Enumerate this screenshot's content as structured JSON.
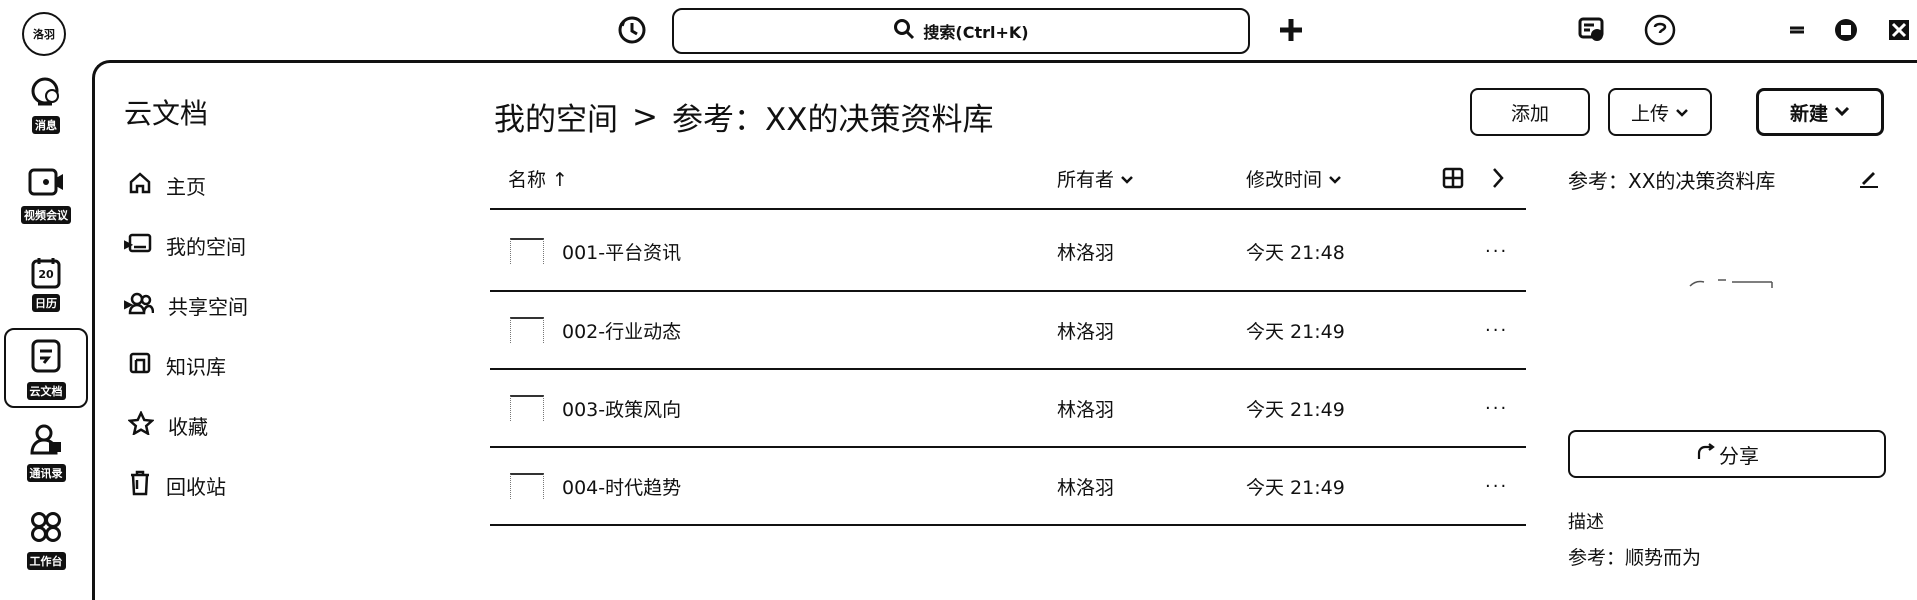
{
  "topbar": {
    "avatar_text": "洛羽",
    "search_label": "搜索(Ctrl+K)"
  },
  "rail": [
    {
      "label": "消息",
      "icon": "chat-icon"
    },
    {
      "label": "视频会议",
      "icon": "video-icon"
    },
    {
      "label": "日历",
      "icon": "calendar-icon",
      "day": "20"
    },
    {
      "label": "云文档",
      "icon": "document-icon",
      "active": true
    },
    {
      "label": "通讯录",
      "icon": "contacts-icon"
    },
    {
      "label": "工作台",
      "icon": "apps-icon"
    }
  ],
  "sidebar": {
    "title": "云文档",
    "items": [
      {
        "label": "主页",
        "icon": "home-icon"
      },
      {
        "label": "我的空间",
        "icon": "folder-icon",
        "expandable": true
      },
      {
        "label": "共享空间",
        "icon": "people-icon",
        "expandable": true
      },
      {
        "label": "知识库",
        "icon": "book-icon"
      },
      {
        "label": "收藏",
        "icon": "star-icon"
      },
      {
        "label": "回收站",
        "icon": "trash-icon"
      }
    ]
  },
  "breadcrumb": {
    "root": "我的空间",
    "separator": ">",
    "current": "参考：XX的决策资料库"
  },
  "toolbar": {
    "add_label": "添加",
    "upload_label": "上传",
    "new_label": "新建"
  },
  "table": {
    "headers": {
      "name": "名称 ↑",
      "owner": "所有者",
      "modified": "修改时间"
    },
    "rows": [
      {
        "name": "001-平台资讯",
        "owner": "林洛羽",
        "modified": "今天 21:48"
      },
      {
        "name": "002-行业动态",
        "owner": "林洛羽",
        "modified": "今天 21:49"
      },
      {
        "name": "003-政策风向",
        "owner": "林洛羽",
        "modified": "今天 21:49"
      },
      {
        "name": "004-时代趋势",
        "owner": "林洛羽",
        "modified": "今天 21:49"
      }
    ]
  },
  "detail": {
    "title": "参考：XX的决策资料库",
    "share_label": "分享",
    "desc_label": "描述",
    "desc_text": "参考：顺势而为"
  }
}
